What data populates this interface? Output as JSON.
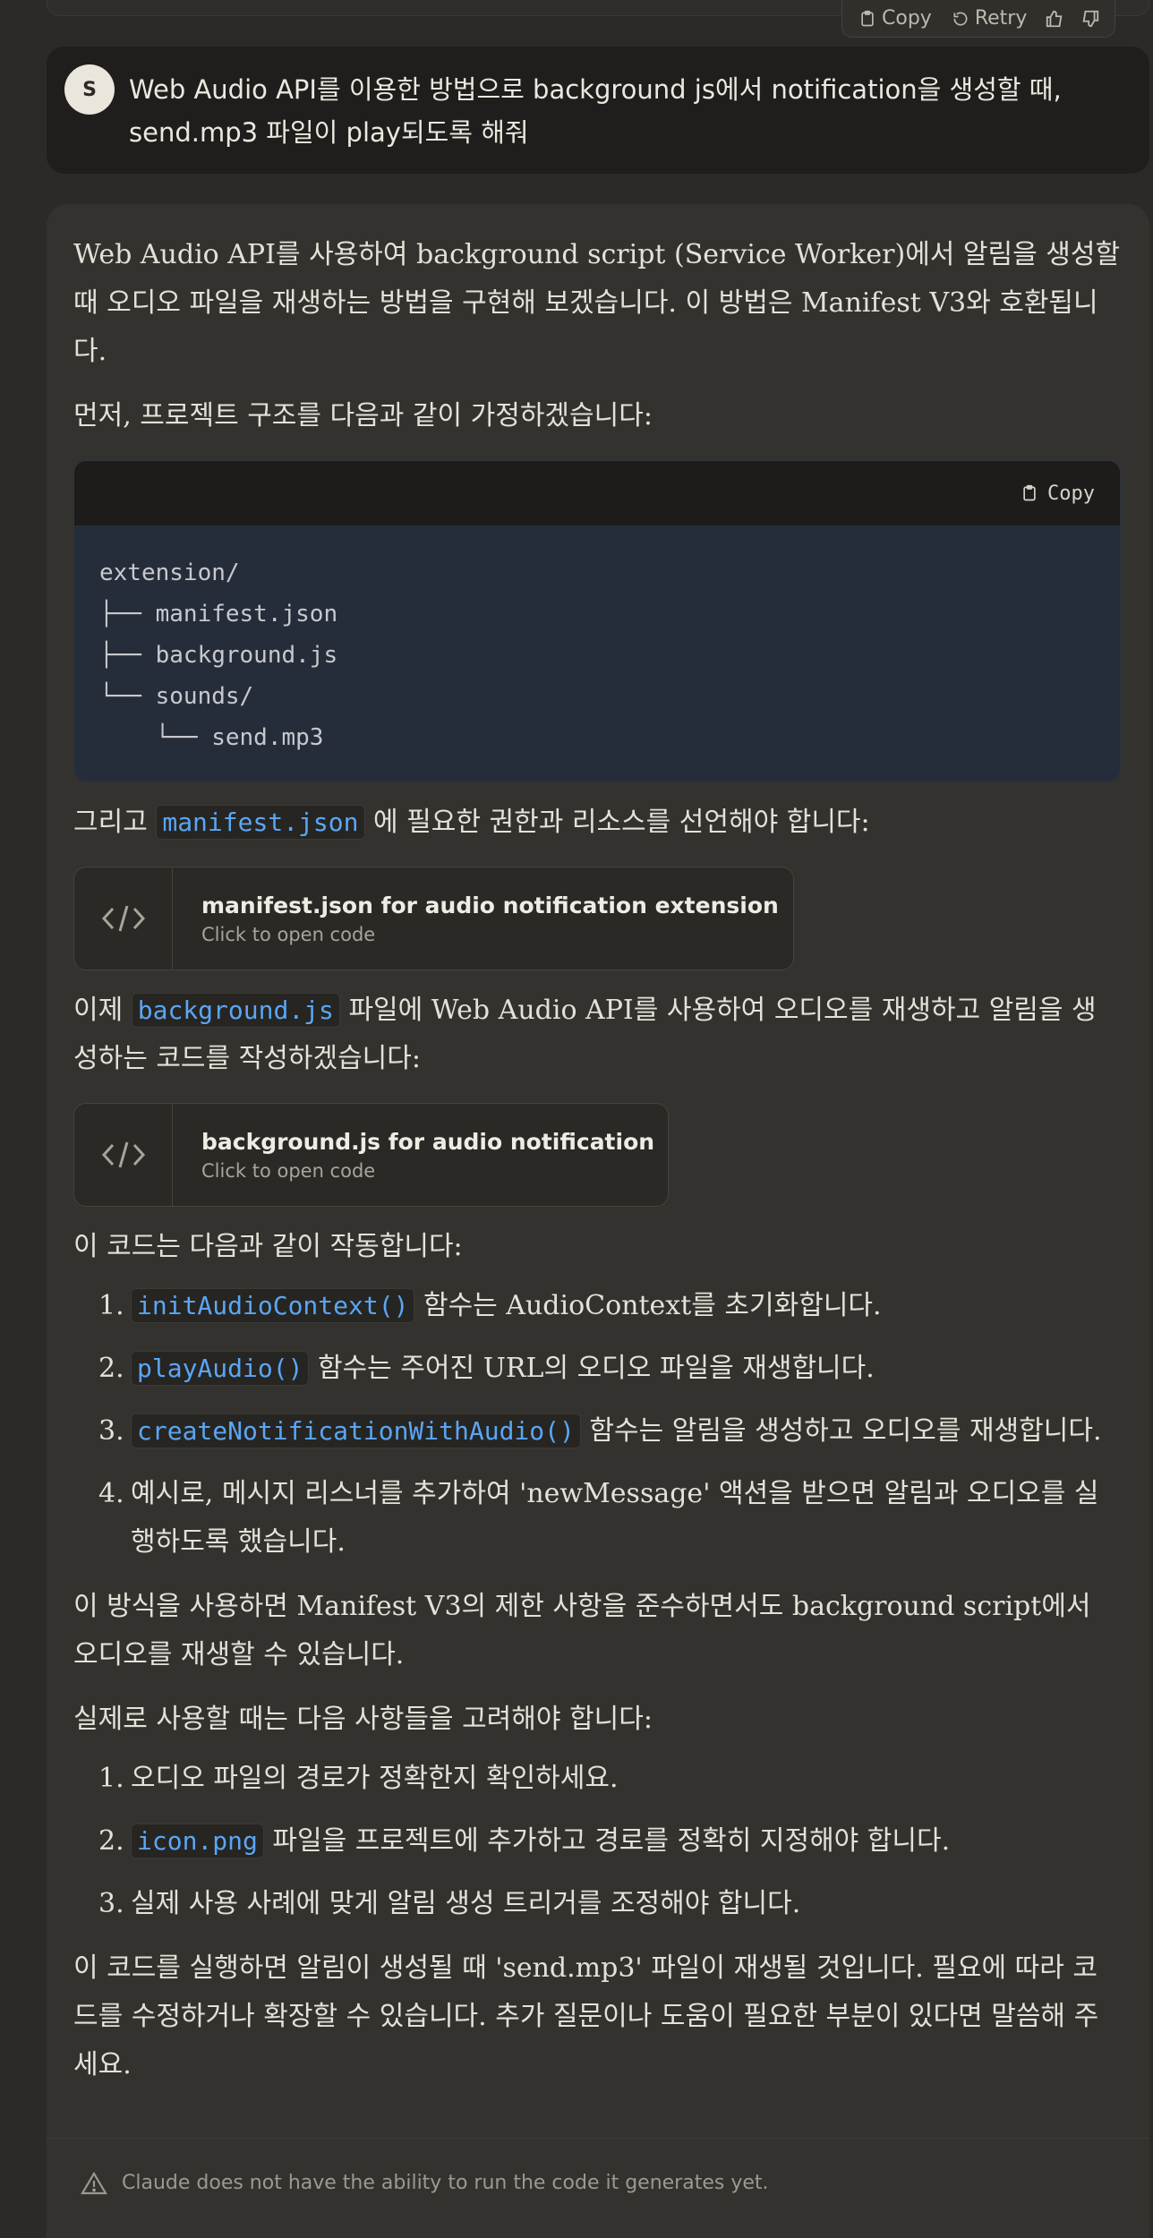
{
  "message_actions": {
    "copy_label": "Copy",
    "retry_label": "Retry"
  },
  "user_message": {
    "avatar_initial": "S",
    "text": "Web Audio API를 이용한 방법으로 background js에서 notification을 생성할 때, send.mp3 파일이 play되도록 해줘"
  },
  "assistant": {
    "p1": "Web Audio API를 사용하여 background script (Service Worker)에서 알림을 생성할 때 오디오 파일을 재생하는 방법을 구현해 보겠습니다. 이 방법은 Manifest V3와 호환됩니다.",
    "p2": "먼저, 프로젝트 구조를 다음과 같이 가정하겠습니다:",
    "codeblock": {
      "copy_label": "Copy",
      "code": "extension/\n├── manifest.json\n├── background.js\n└── sounds/\n    └── send.mp3"
    },
    "p3": {
      "before": "그리고 ",
      "code": "manifest.json",
      "after": " 에 필요한 권한과 리소스를 선언해야 합니다:"
    },
    "artifact1": {
      "title": "manifest.json for audio notification extension",
      "subtitle": "Click to open code"
    },
    "p4": {
      "before": "이제 ",
      "code": "background.js",
      "after": " 파일에 Web Audio API를 사용하여 오디오를 재생하고 알림을 생성하는 코드를 작성하겠습니다:"
    },
    "artifact2": {
      "title": "background.js for audio notification",
      "subtitle": "Click to open code"
    },
    "p5": "이 코드는 다음과 같이 작동합니다:",
    "list1": [
      {
        "num": "1.",
        "code": "initAudioContext()",
        "text": " 함수는 AudioContext를 초기화합니다."
      },
      {
        "num": "2.",
        "code": "playAudio()",
        "text": " 함수는 주어진 URL의 오디오 파일을 재생합니다."
      },
      {
        "num": "3.",
        "code": "createNotificationWithAudio()",
        "text": " 함수는 알림을 생성하고 오디오를 재생합니다."
      },
      {
        "num": "4.",
        "code": "",
        "text": "예시로, 메시지 리스너를 추가하여 'newMessage' 액션을 받으면 알림과 오디오를 실행하도록 했습니다."
      }
    ],
    "p6": "이 방식을 사용하면 Manifest V3의 제한 사항을 준수하면서도 background script에서 오디오를 재생할 수 있습니다.",
    "p7": "실제로 사용할 때는 다음 사항들을 고려해야 합니다:",
    "list2": [
      {
        "num": "1.",
        "code": "",
        "text": "오디오 파일의 경로가 정확한지 확인하세요."
      },
      {
        "num": "2.",
        "code": "icon.png",
        "text": " 파일을 프로젝트에 추가하고 경로를 정확히 지정해야 합니다."
      },
      {
        "num": "3.",
        "code": "",
        "text": "실제 사용 사례에 맞게 알림 생성 트리거를 조정해야 합니다."
      }
    ],
    "p8": "이 코드를 실행하면 알림이 생성될 때 'send.mp3' 파일이 재생될 것입니다. 필요에 따라 코드를 수정하거나 확장할 수 있습니다. 추가 질문이나 도움이 필요한 부분이 있다면 말씀해 주세요.",
    "disclaimer": "Claude does not have the ability to run the code it generates yet."
  }
}
